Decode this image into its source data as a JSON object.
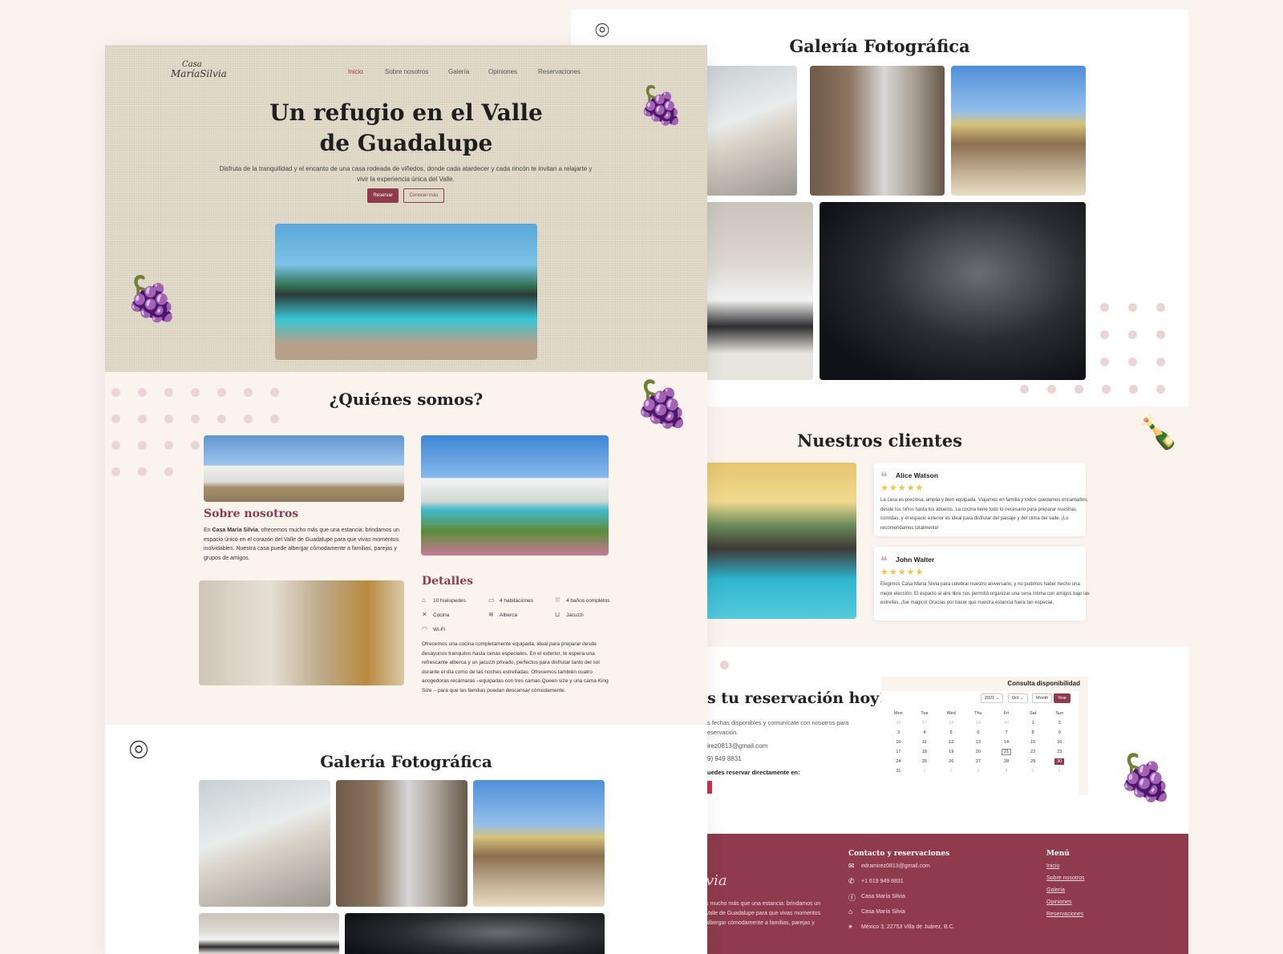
{
  "colors": {
    "accent": "#8f3a4d",
    "cream": "#fbf3ee",
    "dot": "#ead4d6"
  },
  "nav": [
    "Inicio",
    "Sobre nosotros",
    "Galería",
    "Opiniones",
    "Reservaciones"
  ],
  "logo": {
    "line1": "Casa",
    "line2": "MaríaSilvia"
  },
  "hero": {
    "title_l1": "Un refugio en el Valle",
    "title_l2": "de Guadalupe",
    "lead": "Disfruta de la tranquilidad y el encanto de una casa rodeada de viñedos, donde cada atardecer y cada rincón te invitan a relajarte y vivir la experiencia única del Valle.",
    "btn_primary": "Reservar",
    "btn_secondary": "Conocer más"
  },
  "about": {
    "title": "¿Quiénes somos?",
    "sub_title": "Sobre nosotros",
    "text_pre": "En ",
    "text_bold": "Casa María Silvia",
    "text_post": ", ofrecemos mucho más que una estancia: brindamos un espacio único en el corazón del Valle de Guadalupe para que vivas momentos inolvidables. Nuestra casa puede albergar cómodamente a familias, parejas y grupos de amigos."
  },
  "details": {
    "title": "Detalles",
    "items": [
      {
        "icon": "guests-icon",
        "label": "10 huéspedes"
      },
      {
        "icon": "bed-icon",
        "label": "4 habitaciones"
      },
      {
        "icon": "shower-icon",
        "label": "4 baños completos"
      },
      {
        "icon": "kitchen-icon",
        "label": "Cocina"
      },
      {
        "icon": "pool-icon",
        "label": "Alberca"
      },
      {
        "icon": "jacuzzi-icon",
        "label": "Jacuzzi"
      },
      {
        "icon": "wifi-icon",
        "label": "Wi-Fi"
      }
    ],
    "text": "Ofrecemos una cocina completamente equipada, ideal para preparar desde desayunos tranquilos hasta cenas especiales. En el exterior, te espera una refrescante alberca y un jacuzzi privado, perfectos para disfrutar tanto del sol durante el día como de las noches estrelladas. Ofrecemos también cuatro acogedoras recámaras –equipadas con tres camas Queen size y una cama King Size – para que las familias puedan descansar cómodamente."
  },
  "gallery": {
    "title": "Galería Fotográfica"
  },
  "clients": {
    "title": "Nuestros clientes",
    "reviews": [
      {
        "name": "Alice Watson",
        "stars": "★★★★★",
        "rating": 5,
        "text": "La casa es preciosa, amplia y bien equipada. Viajamos en familia y todos quedamos encantados, desde los niños hasta los abuelos. La cocina tiene todo lo necesario para preparar nuestras comidas, y el espacio exterior es ideal para disfrutar del paisaje y del clima del valle. ¡Lo recomendamos totalmente!"
      },
      {
        "name": "John Walter",
        "stars": "★★★★★",
        "rating": 5,
        "text": "Elegimos Casa María Silvia para celebrar nuestro aniversario, y no pudimos haber hecho una mejor elección. El espacio al aire libre nos permitió organizar una cena íntima con amigos bajo las estrellas, ¡fue mágico! Gracias por hacer que nuestra estancia fuera tan especial."
      }
    ]
  },
  "reservation": {
    "title": "s tu reservación hoy!",
    "line1": "s fechas disponibles y comunícate con nosotros para",
    "line2": "eservación.",
    "email": "irez0813@gmail.com",
    "phone": "9) 949 8831",
    "direct": "uedes reservar directamente en:"
  },
  "calendar": {
    "heading": "Consulta disponibilidad",
    "year": "2021",
    "month": "Oct",
    "view_month": "Month",
    "view_year": "Year",
    "days": [
      "Mon",
      "Tue",
      "Wed",
      "Thu",
      "Fri",
      "Sat",
      "Sun"
    ],
    "weeks": [
      [
        "26",
        "27",
        "28",
        "29",
        "30",
        "1",
        "2"
      ],
      [
        "3",
        "4",
        "5",
        "6",
        "7",
        "8",
        "9"
      ],
      [
        "10",
        "11",
        "12",
        "13",
        "14",
        "15",
        "16"
      ],
      [
        "17",
        "18",
        "19",
        "20",
        "21",
        "22",
        "23"
      ],
      [
        "24",
        "25",
        "26",
        "27",
        "28",
        "29",
        "30"
      ],
      [
        "31",
        "1",
        "2",
        "3",
        "4",
        "5",
        "6"
      ]
    ]
  },
  "footer": {
    "contact_title": "Contacto y reservaciones",
    "email": "edramirez0813@gmail.com",
    "phone": "+1 619 949 8831",
    "facebook": "Casa María Silvia",
    "airbnb": "Casa María Silvia",
    "address": "México 3, 22753 Villa de Juárez, B.C.",
    "about_l1": "s mucho más que una estancia: brindamos un",
    "about_l2": "Valle de Guadalupe para que vivas momentos",
    "about_l3": "albergar cómodamente a familias, parejas y",
    "logo_part": "via",
    "menu_title": "Menú",
    "menu": [
      "Inicio",
      "Sobre nosotros",
      "Galería",
      "Opiniones",
      "Reservaciones"
    ]
  }
}
